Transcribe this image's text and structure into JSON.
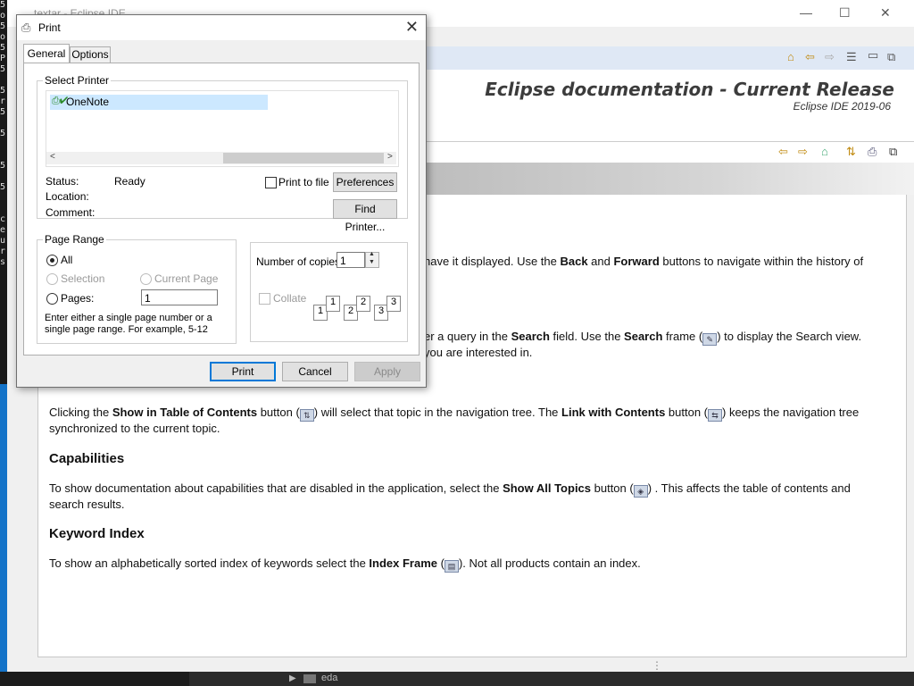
{
  "background_window": {
    "title": "textar - Eclipse IDE",
    "minimize": "—",
    "maximize": "☐",
    "close": "✕",
    "taskbar_item": "eda",
    "left_code_chars": [
      "5",
      "o",
      "5",
      "o",
      "5",
      "P",
      "5",
      "",
      "5",
      "r",
      "5",
      "",
      "5",
      "",
      "",
      "5",
      "",
      "5",
      "",
      "",
      "c",
      "e",
      "u",
      "r",
      "s"
    ]
  },
  "help": {
    "banner_title": "Eclipse documentation - Current Release",
    "banner_subtitle": "Eclipse IDE 2019-06",
    "p1_text": "have it displayed. Use the ",
    "p1_back": "Back",
    "p1_and": " and ",
    "p1_forward": "Forward",
    "p1_rest": " buttons to navigate within the history of",
    "p2_a": "er a query in the ",
    "p2_search": "Search",
    "p2_b": " field. Use the ",
    "p2_search2": "Search",
    "p2_c": " frame (",
    "p2_d": ") to display the Search view.",
    "p2_line2": "you are interested in.",
    "p3_a": "Clicking the ",
    "p3_show": "Show in Table of Contents",
    "p3_b": " button (",
    "p3_c": ") will select that topic in the navigation tree. The ",
    "p3_link": "Link with Contents",
    "p3_d": " button (",
    "p3_e": ") keeps the navigation tree",
    "p3_line2": "synchronized to the current topic.",
    "h_capabilities": "Capabilities",
    "p4_a": "To show documentation about capabilities that are disabled in the application, select the ",
    "p4_show": "Show All Topics",
    "p4_b": " button (",
    "p4_c": ") . This affects the table of contents and",
    "p4_line2": "search results.",
    "h_keyword": "Keyword Index",
    "p5_a": "To show an alphabetically sorted index of keywords select the ",
    "p5_index": "Index Frame",
    "p5_b": " (",
    "p5_c": "). Not all products contain an index."
  },
  "dialog": {
    "title": "Print",
    "close": "✕",
    "tabs": [
      "General",
      "Options"
    ],
    "select_printer": "Select Printer",
    "printer_name": "OneNote",
    "status_label": "Status:",
    "status_value": "Ready",
    "location_label": "Location:",
    "comment_label": "Comment:",
    "print_to_file": "Print to file",
    "preferences": "Preferences",
    "find_printer": "Find Printer...",
    "page_range": "Page Range",
    "all": "All",
    "selection": "Selection",
    "current_page": "Current Page",
    "pages": "Pages:",
    "pages_value": "1",
    "hint": "Enter either a single page number or a single page range.  For example, 5-12",
    "copies_label": "Number of copies:",
    "copies_value": "1",
    "collate": "Collate",
    "collate_nums": [
      "1",
      "1",
      "2",
      "2",
      "3",
      "3"
    ],
    "print": "Print",
    "cancel": "Cancel",
    "apply": "Apply"
  }
}
